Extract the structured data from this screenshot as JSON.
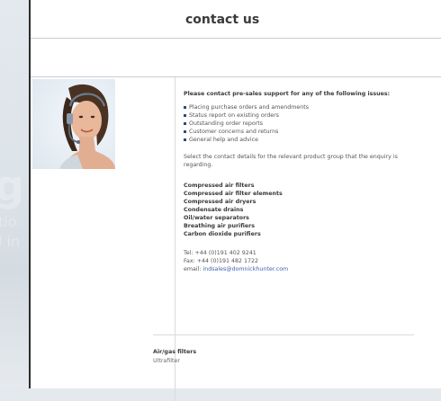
{
  "header": {
    "title": "contact us"
  },
  "intro": "Please contact pre-sales support for any of the following issues:",
  "bullets": [
    "Placing purchase orders and amendments",
    "Status report on existing orders",
    "Outstanding order reports",
    "Customer concerns and returns",
    "General help and advice"
  ],
  "select_text": "Select the contact details for the relevant product group that the enquiry is regarding.",
  "product_groups": [
    "Compressed air filters",
    "Compressed air filter elements",
    "Compressed air dryers",
    "Condensate drains",
    "Oil/water separators",
    "Breathing air purifiers",
    "Carbon dioxide purifiers"
  ],
  "contact": {
    "tel": "Tel: +44 (0)191 402 9241",
    "fax": "Fax: +44 (0)191 482 1722",
    "email_label": "email: ",
    "email": "indsales@domnickhunter.com"
  },
  "section": {
    "heading": "Air/gas filters",
    "sub": "Ultrafilter"
  },
  "background": {
    "ghost_large": "g",
    "ghost_small_1": "tio",
    "ghost_small_2": "l in"
  },
  "colors": {
    "link": "#3f64b5",
    "bullet": "#2e4a7a"
  }
}
